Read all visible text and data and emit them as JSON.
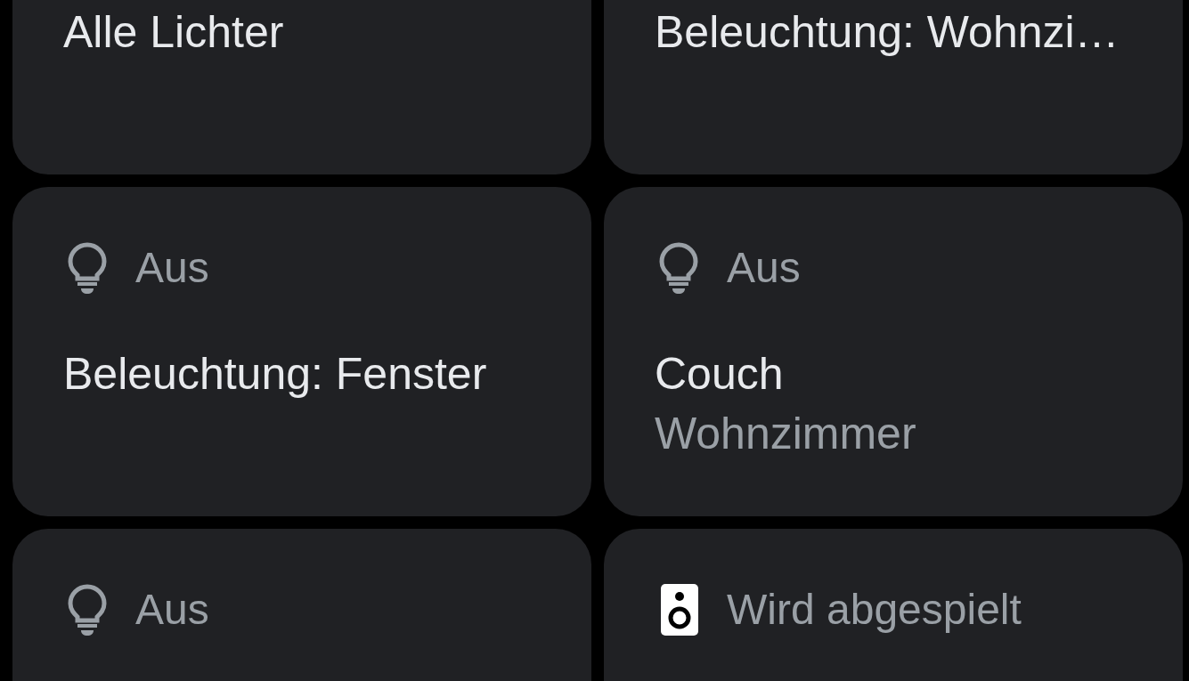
{
  "tiles": [
    {
      "title": "Alle Lichter"
    },
    {
      "title": "Beleuchtung: Wohnzi…"
    },
    {
      "status": {
        "kind": "bulb",
        "text": "Aus"
      },
      "title": "Beleuchtung: Fenster"
    },
    {
      "status": {
        "kind": "bulb",
        "text": "Aus"
      },
      "title": "Couch",
      "subtitle": "Wohnzimmer"
    },
    {
      "status": {
        "kind": "bulb",
        "text": "Aus"
      }
    },
    {
      "status": {
        "kind": "speaker",
        "text": "Wird abgespielt"
      }
    }
  ]
}
